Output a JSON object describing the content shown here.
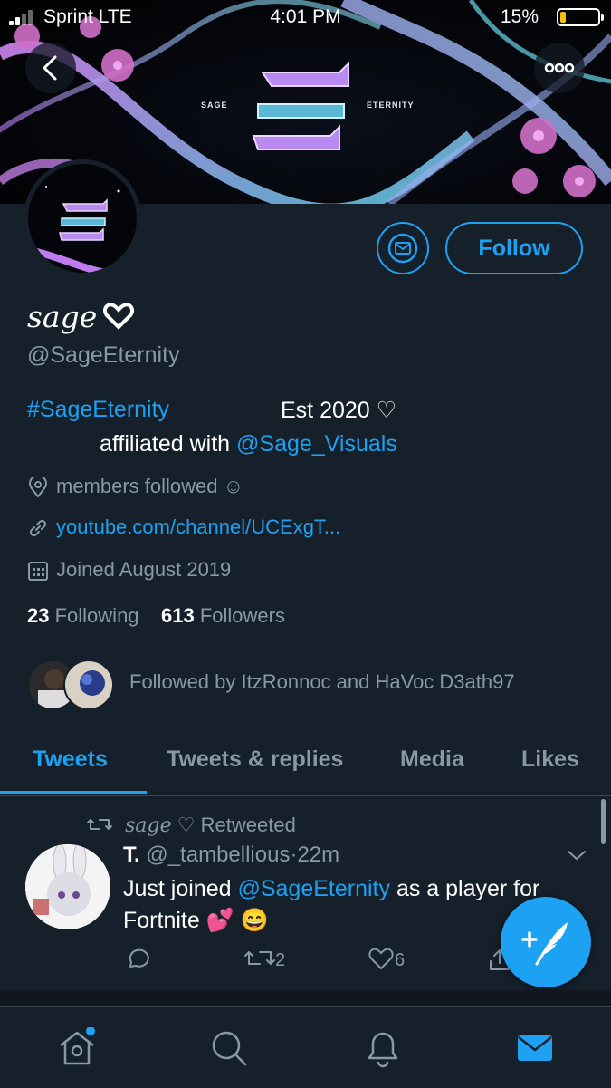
{
  "status_bar": {
    "carrier": "Sprint LTE",
    "time": "4:01 PM",
    "battery_pct": "15%",
    "battery_level": 0.15
  },
  "banner": {
    "left_text": "SAGE",
    "right_text": "ETERNITY"
  },
  "profile": {
    "name": "sage",
    "handle": "@SageEternity",
    "follow_label": "Follow",
    "bio": {
      "hashtag": "#SageEternity",
      "est": "Est 2020 ♡",
      "affiliated_prefix": "affiliated with ",
      "affiliated_link": "@Sage_Visuals"
    },
    "location": "members followed ☺",
    "website": "youtube.com/channel/UCExgT...",
    "joined": "Joined August 2019",
    "following_count": "23",
    "following_label": "Following",
    "followers_count": "613",
    "followers_label": "Followers",
    "followed_by": "Followed by ItzRonnoc and HaVoc D3ath97"
  },
  "tabs": [
    {
      "label": "Tweets",
      "active": true
    },
    {
      "label": "Tweets & replies",
      "active": false
    },
    {
      "label": "Media",
      "active": false
    },
    {
      "label": "Likes",
      "active": false
    }
  ],
  "tweet": {
    "retweet_by": "sage",
    "retweet_label": "Retweeted",
    "author_name": "T.",
    "author_handle": "@_tambellious",
    "time": "22m",
    "text_prefix": "Just joined ",
    "text_mention": "@SageEternity",
    "text_suffix": " as a player for Fortnite 💕  😄",
    "retweets": "2",
    "likes": "6"
  },
  "colors": {
    "accent": "#1da1f2",
    "background": "#15202b",
    "muted": "#8899a6"
  },
  "icons": [
    "back-icon",
    "more-icon",
    "mail-icon",
    "location-icon",
    "link-icon",
    "calendar-icon",
    "retweet-icon",
    "chevron-down-icon",
    "reply-icon",
    "like-icon",
    "share-icon",
    "compose-icon",
    "home-icon",
    "search-icon",
    "notifications-icon",
    "messages-icon"
  ]
}
